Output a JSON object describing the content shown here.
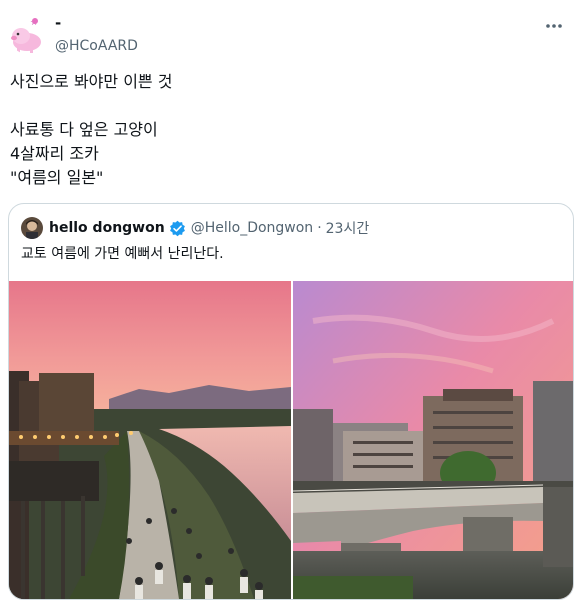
{
  "author": {
    "display_name": "-",
    "handle": "@HCoAARD",
    "avatar_icon": "pink-pig-sticker-icon"
  },
  "more_icon": "more-options-icon",
  "tweet": {
    "lines": [
      "사진으로 봐야만 이쁜 것",
      "",
      "사료통 다 엎은 고양이",
      "4살짜리 조카",
      "\"여름의 일본\""
    ]
  },
  "quote": {
    "display_name": "hello dongwon",
    "handle": "@Hello_Dongwon",
    "separator": "·",
    "time": "23시간",
    "text": "교토 여름에 가면 예뻐서 난리난다.",
    "verified_icon": "verified-badge-icon",
    "photos": [
      {
        "description_icon": "kyoto-riverbank-sunset-photo"
      },
      {
        "description_icon": "kyoto-bridge-sunset-photo"
      }
    ]
  },
  "colors": {
    "text": "#0f1419",
    "secondary": "#536471",
    "border": "#cfd9de",
    "verified": "#1d9bf0"
  }
}
